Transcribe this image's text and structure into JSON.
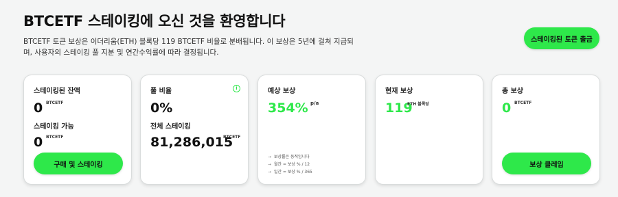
{
  "header": {
    "title": "BTCETF 스테이킹에 오신 것을 환영합니다",
    "description": "BTCETF 토큰 보상은 이더리움(ETH) 블록당 119 BTCETF 비율로 분배됩니다. 이 보상은 5년에 걸쳐 지급되며, 사용자의 스테이킹 풀 지분 및 연간수익률에 따라 결정됩니다.",
    "withdraw_button": "스테이킹된 토큰 출금"
  },
  "cards": {
    "balance": {
      "staked_label": "스테이킹된 잔액",
      "staked_value": "0",
      "staked_unit": "BTCETF",
      "available_label": "스테이킹 가능",
      "available_value": "0",
      "available_unit": "BTCETF",
      "button": "구매 및 스테이킹"
    },
    "pool": {
      "label": "풀 비율",
      "info_icon": "info-icon",
      "value": "0%",
      "total_label": "전체 스테이킹",
      "total_value": "81,286,015",
      "total_unit": "BTCETF"
    },
    "estimated": {
      "label": "예상 보상",
      "value": "354%",
      "unit": "p/a",
      "notes": [
        "보상률은 동적입니다",
        "월간 = 보상 % / 12",
        "일간 = 보상 % / 365"
      ]
    },
    "current": {
      "label": "현재 보상",
      "value": "119",
      "unit": "ETH 블록당"
    },
    "total": {
      "label": "총 보상",
      "value": "0",
      "unit": "BTCETF",
      "button": "보상 클레임"
    }
  },
  "colors": {
    "accent": "#2ee84a",
    "background": "#f4f5f5",
    "card": "#ffffff"
  }
}
